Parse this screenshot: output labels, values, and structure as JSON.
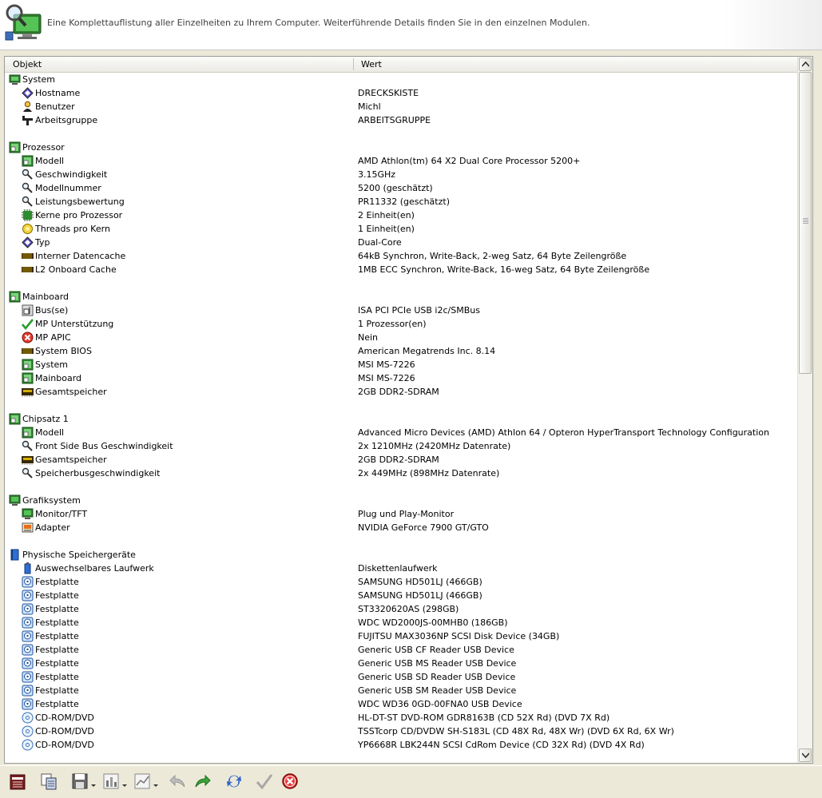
{
  "header": {
    "description": "Eine Komplettauflistung aller Einzelheiten zu Ihrem Computer. Weiterführende Details finden Sie in den einzelnen Modulen."
  },
  "columns": {
    "object": "Objekt",
    "value": "Wert"
  },
  "rows": [
    {
      "type": "group",
      "icon": "system-icon",
      "label": "System",
      "value": ""
    },
    {
      "type": "item",
      "icon": "diamond-icon",
      "label": "Hostname",
      "value": "DRECKSKISTE"
    },
    {
      "type": "item",
      "icon": "user-icon",
      "label": "Benutzer",
      "value": "Michl"
    },
    {
      "type": "item",
      "icon": "network-icon",
      "label": "Arbeitsgruppe",
      "value": "ARBEITSGRUPPE"
    },
    {
      "type": "blank",
      "icon": "",
      "label": "",
      "value": ""
    },
    {
      "type": "group",
      "icon": "chip-icon",
      "label": "Prozessor",
      "value": ""
    },
    {
      "type": "item",
      "icon": "chip-icon",
      "label": "Modell",
      "value": "AMD Athlon(tm) 64 X2 Dual Core Processor 5200+"
    },
    {
      "type": "item",
      "icon": "magnifier-icon",
      "label": "Geschwindigkeit",
      "value": "3.15GHz"
    },
    {
      "type": "item",
      "icon": "magnifier-icon",
      "label": "Modellnummer",
      "value": "5200 (geschätzt)"
    },
    {
      "type": "item",
      "icon": "magnifier-icon",
      "label": "Leistungsbewertung",
      "value": "PR11332 (geschätzt)"
    },
    {
      "type": "item",
      "icon": "core-icon",
      "label": "Kerne pro Prozessor",
      "value": "2 Einheit(en)"
    },
    {
      "type": "item",
      "icon": "thread-icon",
      "label": "Threads pro Kern",
      "value": "1 Einheit(en)"
    },
    {
      "type": "item",
      "icon": "diamond-icon",
      "label": "Typ",
      "value": "Dual-Core"
    },
    {
      "type": "item",
      "icon": "memory-icon",
      "label": "Interner Datencache",
      "value": "64kB Synchron, Write-Back, 2-weg Satz, 64 Byte Zeilengröße"
    },
    {
      "type": "item",
      "icon": "memory-icon",
      "label": "L2 Onboard Cache",
      "value": "1MB ECC Synchron, Write-Back, 16-weg Satz, 64 Byte Zeilengröße"
    },
    {
      "type": "blank",
      "icon": "",
      "label": "",
      "value": ""
    },
    {
      "type": "group",
      "icon": "chip-icon",
      "label": "Mainboard",
      "value": ""
    },
    {
      "type": "item",
      "icon": "bus-icon",
      "label": "Bus(se)",
      "value": "ISA PCI PCIe USB i2c/SMBus"
    },
    {
      "type": "item",
      "icon": "check-icon",
      "label": "MP Unterstützung",
      "value": "1 Prozessor(en)"
    },
    {
      "type": "item",
      "icon": "error-icon",
      "label": "MP APIC",
      "value": "Nein"
    },
    {
      "type": "item",
      "icon": "memory-icon",
      "label": "System BIOS",
      "value": "American Megatrends Inc. 8.14"
    },
    {
      "type": "item",
      "icon": "chip-icon",
      "label": "System",
      "value": "MSI MS-7226"
    },
    {
      "type": "item",
      "icon": "chip-icon",
      "label": "Mainboard",
      "value": "MSI MS-7226"
    },
    {
      "type": "item",
      "icon": "ram-icon",
      "label": "Gesamtspeicher",
      "value": "2GB DDR2-SDRAM"
    },
    {
      "type": "blank",
      "icon": "",
      "label": "",
      "value": ""
    },
    {
      "type": "group",
      "icon": "chip-icon",
      "label": "Chipsatz 1",
      "value": ""
    },
    {
      "type": "item",
      "icon": "chip-icon",
      "label": "Modell",
      "value": "Advanced Micro Devices (AMD) Athlon 64 / Opteron HyperTransport Technology Configuration"
    },
    {
      "type": "item",
      "icon": "magnifier-icon",
      "label": "Front Side Bus Geschwindigkeit",
      "value": "2x 1210MHz (2420MHz Datenrate)"
    },
    {
      "type": "item",
      "icon": "ram-icon",
      "label": "Gesamtspeicher",
      "value": "2GB DDR2-SDRAM"
    },
    {
      "type": "item",
      "icon": "magnifier-icon",
      "label": "Speicherbusgeschwindigkeit",
      "value": "2x 449MHz (898MHz Datenrate)"
    },
    {
      "type": "blank",
      "icon": "",
      "label": "",
      "value": ""
    },
    {
      "type": "group",
      "icon": "monitor-icon",
      "label": "Grafiksystem",
      "value": ""
    },
    {
      "type": "item",
      "icon": "monitor-icon",
      "label": "Monitor/TFT",
      "value": "Plug und Play-Monitor"
    },
    {
      "type": "item",
      "icon": "adapter-icon",
      "label": "Adapter",
      "value": "NVIDIA GeForce 7900 GT/GTO"
    },
    {
      "type": "blank",
      "icon": "",
      "label": "",
      "value": ""
    },
    {
      "type": "group",
      "icon": "book-icon",
      "label": "Physische Speichergeräte",
      "value": ""
    },
    {
      "type": "item",
      "icon": "removable-icon",
      "label": "Auswechselbares Laufwerk",
      "value": "Diskettenlaufwerk"
    },
    {
      "type": "item",
      "icon": "disk-icon",
      "label": "Festplatte",
      "value": "SAMSUNG HD501LJ (466GB)"
    },
    {
      "type": "item",
      "icon": "disk-icon",
      "label": "Festplatte",
      "value": "SAMSUNG HD501LJ (466GB)"
    },
    {
      "type": "item",
      "icon": "disk-icon",
      "label": "Festplatte",
      "value": "ST3320620AS (298GB)"
    },
    {
      "type": "item",
      "icon": "disk-icon",
      "label": "Festplatte",
      "value": "WDC WD2000JS-00MHB0 (186GB)"
    },
    {
      "type": "item",
      "icon": "disk-icon",
      "label": "Festplatte",
      "value": "FUJITSU MAX3036NP SCSI Disk Device (34GB)"
    },
    {
      "type": "item",
      "icon": "disk-icon",
      "label": "Festplatte",
      "value": "Generic USB CF Reader USB Device"
    },
    {
      "type": "item",
      "icon": "disk-icon",
      "label": "Festplatte",
      "value": "Generic USB MS Reader USB Device"
    },
    {
      "type": "item",
      "icon": "disk-icon",
      "label": "Festplatte",
      "value": "Generic USB SD Reader USB Device"
    },
    {
      "type": "item",
      "icon": "disk-icon",
      "label": "Festplatte",
      "value": "Generic USB SM Reader USB Device"
    },
    {
      "type": "item",
      "icon": "disk-icon",
      "label": "Festplatte",
      "value": "WDC WD36 0GD-00FNA0 USB Device"
    },
    {
      "type": "item",
      "icon": "cd-icon",
      "label": "CD-ROM/DVD",
      "value": "HL-DT-ST DVD-ROM GDR8163B (CD 52X Rd) (DVD 7X Rd)"
    },
    {
      "type": "item",
      "icon": "cd-icon",
      "label": "CD-ROM/DVD",
      "value": "TSSTcorp CD/DVDW SH-S183L (CD 48X Rd, 48X Wr) (DVD 6X Rd, 6X Wr)"
    },
    {
      "type": "item",
      "icon": "cd-icon",
      "label": "CD-ROM/DVD",
      "value": "YP6668R LBK244N SCSI CdRom Device (CD 32X Rd) (DVD 4X Rd)"
    }
  ],
  "toolbar": [
    {
      "name": "report-button",
      "icon": "report-icon"
    },
    {
      "name": "copy-button",
      "icon": "copy-icon"
    },
    {
      "name": "save-button",
      "icon": "save-icon",
      "dropdown": true
    },
    {
      "name": "chart-button",
      "icon": "chart-icon",
      "dropdown": true
    },
    {
      "name": "graph-button",
      "icon": "graph-icon",
      "dropdown": true
    },
    {
      "name": "back-button",
      "icon": "back-arrow-icon"
    },
    {
      "name": "forward-button",
      "icon": "forward-arrow-icon"
    },
    {
      "name": "refresh-button",
      "icon": "refresh-icon"
    },
    {
      "name": "ok-button",
      "icon": "check-icon"
    },
    {
      "name": "close-button",
      "icon": "cancel-icon"
    }
  ]
}
